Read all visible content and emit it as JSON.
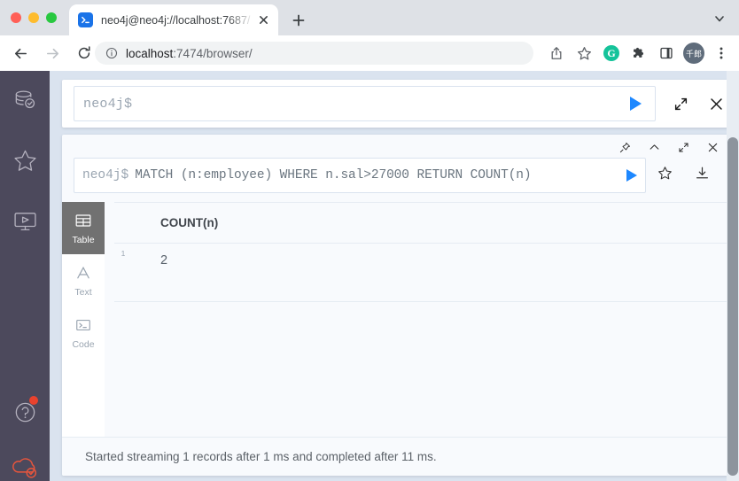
{
  "browser": {
    "tab": {
      "title": "neo4j@neo4j://localhost:7687/",
      "favicon_icon": "terminal-icon",
      "close_icon": "close-icon"
    },
    "new_tab_label": "+",
    "tab_search_icon": "chevron-down-icon",
    "nav": {
      "back_icon": "arrow-left-icon",
      "forward_icon": "arrow-right-icon",
      "reload_icon": "reload-icon"
    },
    "omnibox": {
      "info_icon": "info-circle-icon",
      "url_host": "localhost",
      "url_path": ":7474/browser/"
    },
    "toolbar_icons": [
      {
        "name": "share-icon",
        "label": ""
      },
      {
        "name": "bookmark-star-icon",
        "label": ""
      },
      {
        "name": "grammarly-icon",
        "label": "G"
      },
      {
        "name": "extensions-puzzle-icon",
        "label": ""
      },
      {
        "name": "side-panel-icon",
        "label": ""
      },
      {
        "name": "profile-avatar",
        "label": "千郎"
      },
      {
        "name": "chrome-menu-icon",
        "label": ""
      }
    ]
  },
  "neo4j": {
    "sidebar": {
      "items": [
        {
          "name": "database-icon",
          "label": "Database Information"
        },
        {
          "name": "star-favorites-icon",
          "label": "Favorites"
        },
        {
          "name": "guides-monitor-icon",
          "label": "Browser Guides"
        }
      ],
      "bottom_items": [
        {
          "name": "help-icon",
          "label": "Help",
          "badge": true
        },
        {
          "name": "cloud-icon",
          "label": "Neo4j Aura",
          "badge": false
        }
      ]
    },
    "editor": {
      "prompt": "neo4j$",
      "value": "",
      "placeholder": "neo4j$",
      "run_icon": "play-icon",
      "expand_icon": "expand-icon",
      "close_icon": "close-icon"
    },
    "frame": {
      "controls": [
        {
          "name": "pin-icon",
          "label": "Pin"
        },
        {
          "name": "chevron-up-icon",
          "label": "Collapse"
        },
        {
          "name": "expand-icon",
          "label": "Fullscreen"
        },
        {
          "name": "close-icon",
          "label": "Close"
        }
      ],
      "query_prompt": "neo4j$",
      "query_text": "MATCH (n:employee) WHERE n.sal>27000 RETURN COUNT(n)",
      "run_icon": "play-icon",
      "actions": [
        {
          "name": "save-favorite-star-icon",
          "label": "Save as favorite"
        },
        {
          "name": "download-icon",
          "label": "Export"
        }
      ],
      "view_tabs": [
        {
          "name": "tab-table",
          "label": "Table",
          "icon": "table-icon",
          "active": true
        },
        {
          "name": "tab-text",
          "label": "Text",
          "icon": "text-icon",
          "active": false
        },
        {
          "name": "tab-code",
          "label": "Code",
          "icon": "code-icon",
          "active": false
        }
      ],
      "table": {
        "columns": [
          "COUNT(n)"
        ],
        "rows": [
          {
            "index": "1",
            "cells": [
              "2"
            ]
          }
        ]
      },
      "status": "Started streaming 1 records after 1 ms and completed after 11 ms."
    }
  },
  "colors": {
    "accent_blue": "#1e88ff",
    "sidebar_bg": "#4c495c",
    "page_bg": "#dae3ef",
    "frame_bg": "#f8fafd",
    "notification_red": "#e8422e",
    "cloud_red": "#e8553c"
  }
}
